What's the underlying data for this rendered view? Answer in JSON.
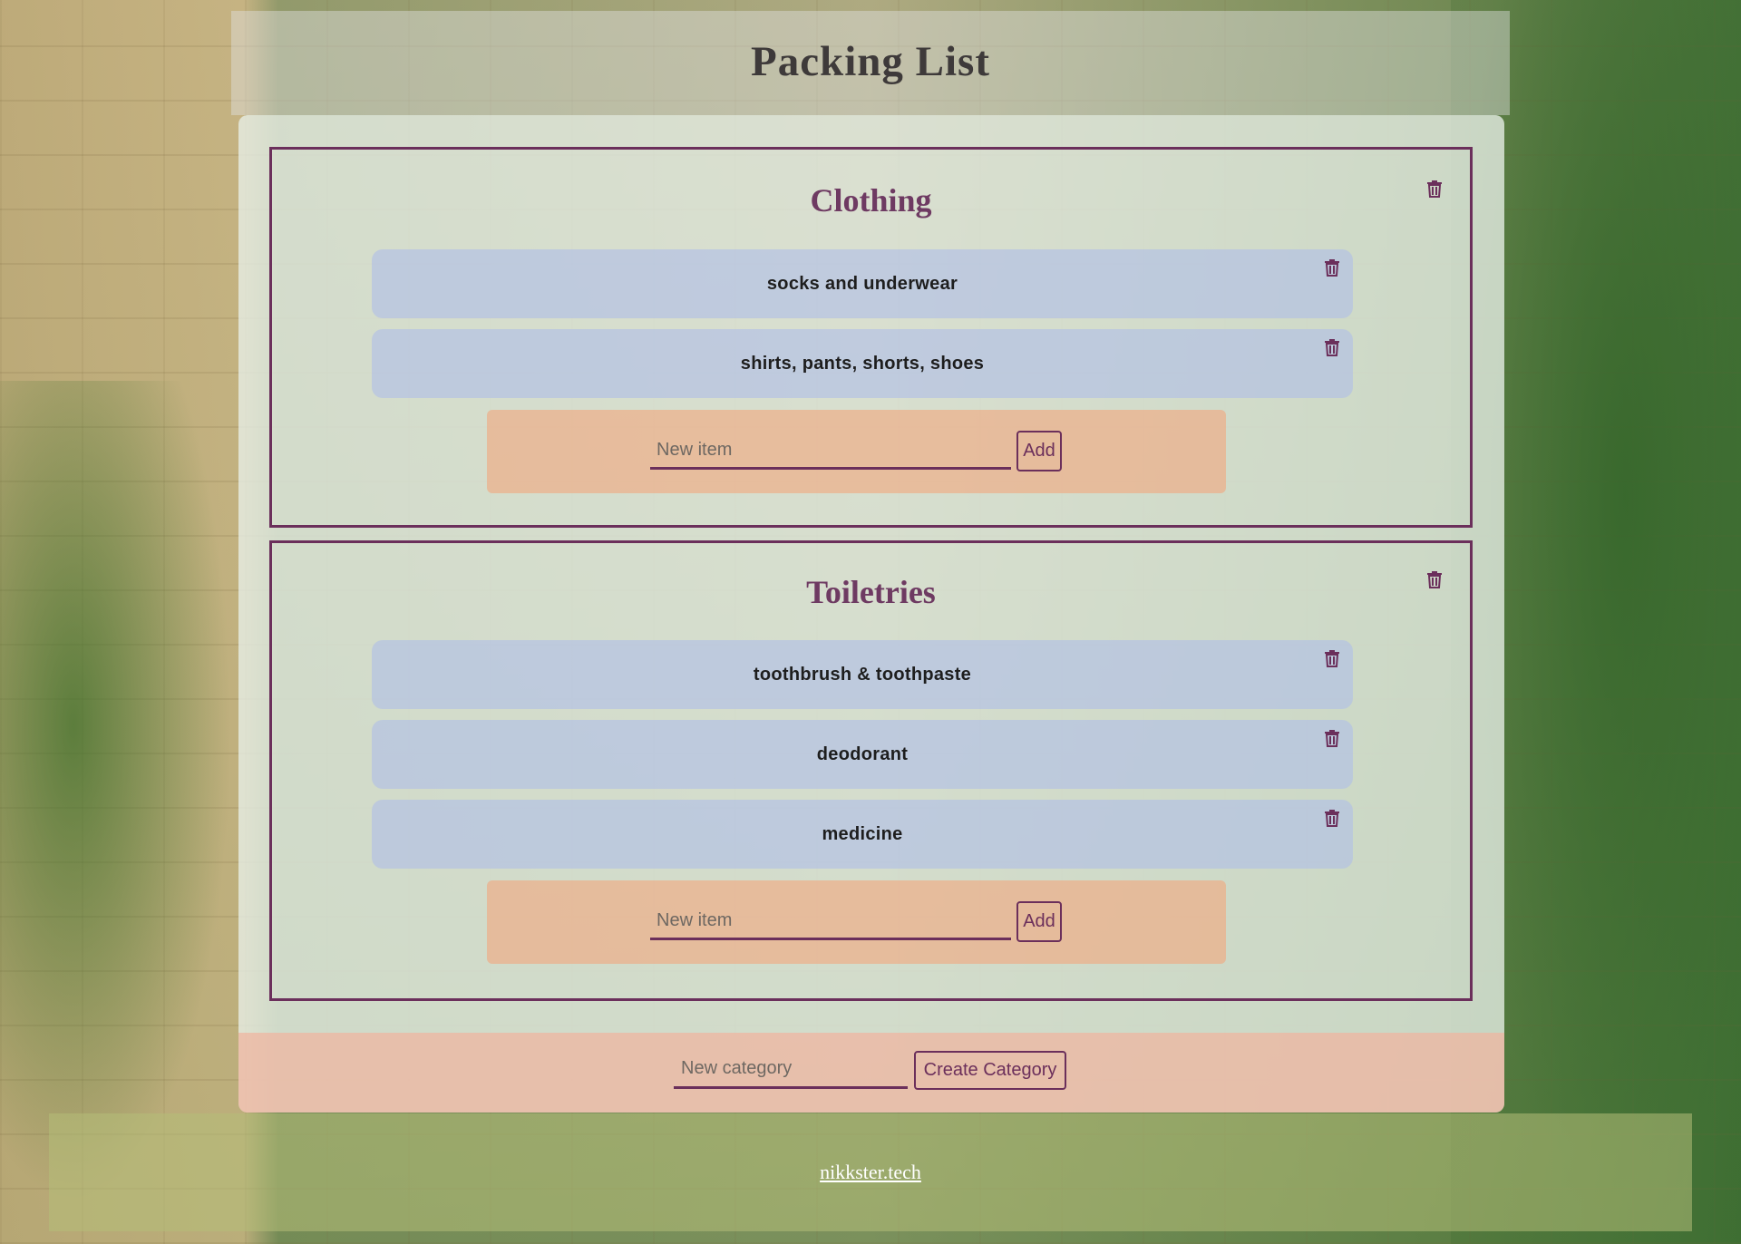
{
  "page": {
    "title": "Packing List"
  },
  "categories": [
    {
      "title": "Clothing",
      "items": [
        {
          "label": "socks and underwear"
        },
        {
          "label": "shirts, pants, shorts, shoes"
        }
      ],
      "new_item_placeholder": "New item",
      "add_label": "Add"
    },
    {
      "title": "Toiletries",
      "items": [
        {
          "label": "toothbrush & toothpaste"
        },
        {
          "label": "deodorant"
        },
        {
          "label": "medicine"
        }
      ],
      "new_item_placeholder": "New item",
      "add_label": "Add"
    }
  ],
  "new_category": {
    "placeholder": "New category",
    "button_label": "Create Category"
  },
  "footer": {
    "link_text": "nikkster.tech"
  },
  "colors": {
    "accent": "#6b2f5b",
    "item_background": "#b0bee6",
    "form_background": "#f0aa82"
  },
  "icons": {
    "delete": "trash-icon"
  }
}
